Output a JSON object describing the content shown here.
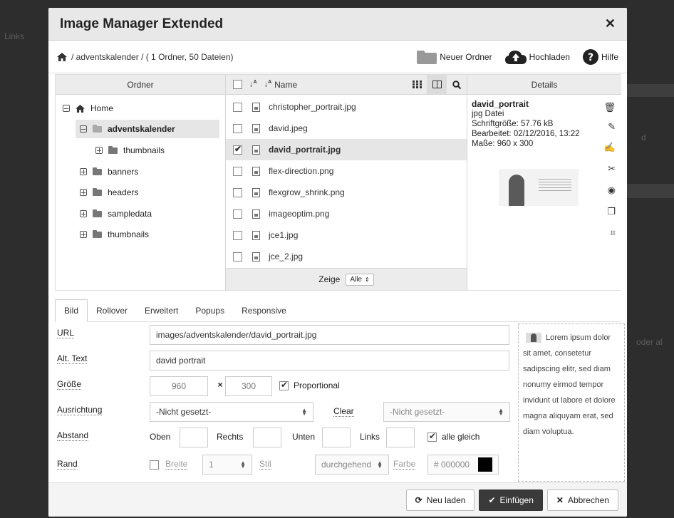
{
  "backdrop": {
    "left_text": "Links",
    "right_text_1": "d",
    "right_text_2": "oder al"
  },
  "dialog": {
    "title": "Image Manager Extended"
  },
  "topbar": {
    "breadcrumb": "/ adventskalender / ( 1 Ordner, 50 Dateien)",
    "new_folder": "Neuer Ordner",
    "upload": "Hochladen",
    "help": "Hilfe"
  },
  "folders_pane": {
    "header": "Ordner",
    "items": [
      {
        "label": "Home"
      },
      {
        "label": "adventskalender"
      },
      {
        "label": "thumbnails"
      },
      {
        "label": "banners"
      },
      {
        "label": "headers"
      },
      {
        "label": "sampledata"
      },
      {
        "label": "thumbnails"
      }
    ]
  },
  "files_pane": {
    "name_header": "Name",
    "files": [
      {
        "name": "christopher_portrait.jpg",
        "checked": false
      },
      {
        "name": "david.jpeg",
        "checked": false
      },
      {
        "name": "david_portrait.jpg",
        "checked": true
      },
      {
        "name": "flex-direction.png",
        "checked": false
      },
      {
        "name": "flexgrow_shrink.png",
        "checked": false
      },
      {
        "name": "imageoptim.png",
        "checked": false
      },
      {
        "name": "jce1.jpg",
        "checked": false
      },
      {
        "name": "jce_2.jpg",
        "checked": false
      }
    ],
    "show_label": "Zeige",
    "show_value": "Alle"
  },
  "details_pane": {
    "header": "Details",
    "name": "david_portrait",
    "type": "jpg Datei",
    "size": "Schriftgröße: 57.76 kB",
    "modified": "Bearbeitet: 02/12/2016, 13:22",
    "dimensions": "Maße: 960 x 300"
  },
  "tabs": [
    "Bild",
    "Rollover",
    "Erweitert",
    "Popups",
    "Responsive"
  ],
  "form": {
    "url_label": "URL",
    "url_value": "images/adventskalender/david_portrait.jpg",
    "alt_label": "Alt. Text",
    "alt_value": "david portrait",
    "size_label": "Größe",
    "width": "960",
    "times": "×",
    "height": "300",
    "proportional": "Proportional",
    "align_label": "Ausrichtung",
    "align_value": "-Nicht gesetzt-",
    "clear_label": "Clear",
    "clear_value": "-Nicht gesetzt-",
    "spacing_label": "Abstand",
    "top": "Oben",
    "right": "Rechts",
    "bottom": "Unten",
    "left": "Links",
    "all_equal": "alle gleich",
    "border_label": "Rand",
    "border_width": "Breite",
    "border_width_value": "1",
    "style": "Stil",
    "style_value": "durchgehend",
    "color": "Farbe",
    "color_value": "# 000000",
    "color_swatch": "#000000"
  },
  "preview_text": "Lorem ipsum dolor sit amet, consetetur sadipscing elitr, sed diam nonumy eirmod tempor invidunt ut labore et dolore magna aliquyam erat, sed diam voluptua.",
  "footer": {
    "reload": "Neu laden",
    "insert": "Einfügen",
    "cancel": "Abbrechen"
  }
}
